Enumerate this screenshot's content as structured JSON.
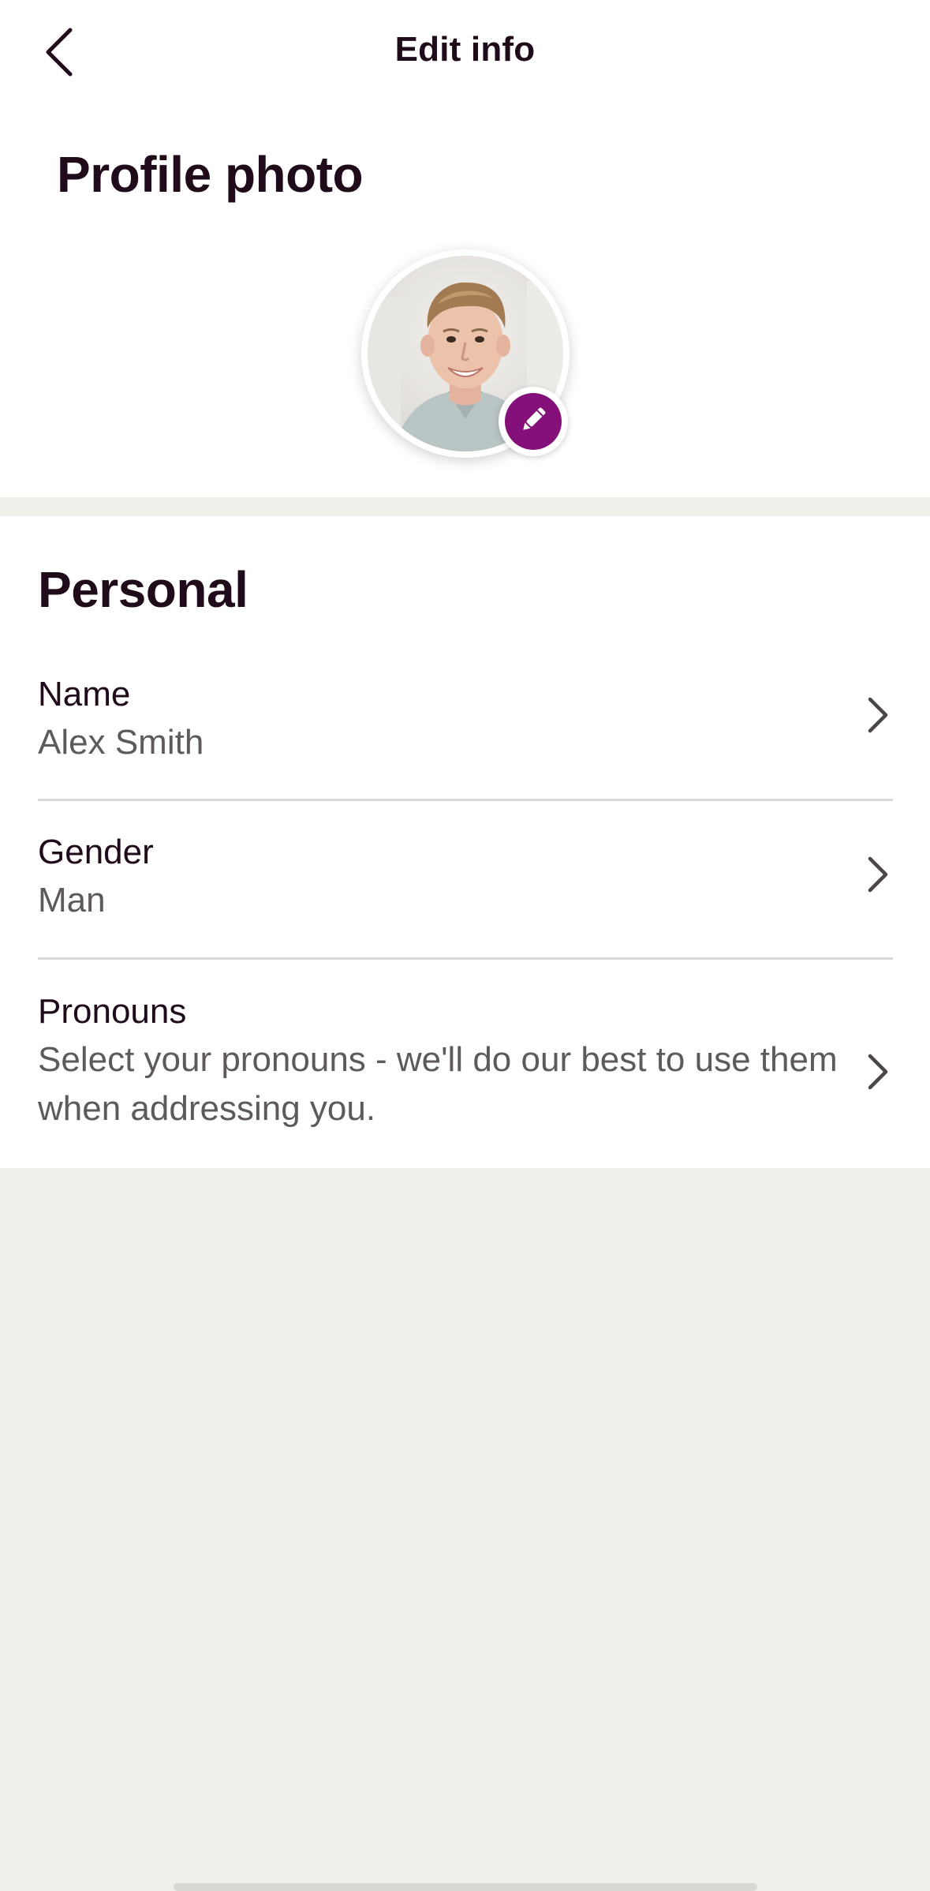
{
  "header": {
    "title": "Edit info",
    "back_icon": "chevron-left-icon"
  },
  "photo": {
    "section_title": "Profile photo",
    "edit_icon": "pencil-icon",
    "accent_color": "#85107a"
  },
  "personal": {
    "section_title": "Personal",
    "rows": [
      {
        "label": "Name",
        "value": "Alex Smith",
        "icon": "chevron-right-icon"
      },
      {
        "label": "Gender",
        "value": "Man",
        "icon": "chevron-right-icon"
      },
      {
        "label": "Pronouns",
        "value": "Select your pronouns - we'll do our best to use them when addressing you.",
        "icon": "chevron-right-icon"
      }
    ]
  },
  "colors": {
    "text_primary": "#1f0b1a",
    "text_secondary": "#5e5a5c",
    "page_background": "#f0efec",
    "divider": "#d8d6d6"
  }
}
